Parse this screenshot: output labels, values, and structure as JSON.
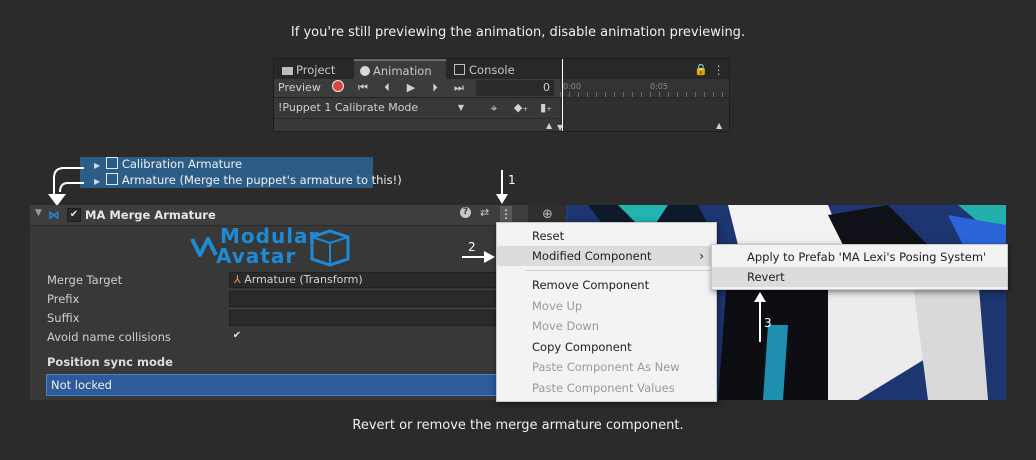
{
  "captions": {
    "top": "If you're still previewing the animation, disable animation previewing.",
    "bottom": "Revert or remove the merge armature component."
  },
  "animation_window": {
    "tabs": [
      {
        "label": "Project",
        "icon": "folder-icon"
      },
      {
        "label": "Animation",
        "icon": "clock-icon",
        "active": true
      },
      {
        "label": "Console",
        "icon": "console-icon"
      }
    ],
    "preview_label": "Preview",
    "frame_value": "0",
    "clip_name": "!Puppet 1 Calibrate Mode",
    "ticks": [
      "0:00",
      "0:05"
    ]
  },
  "hierarchy": {
    "items": [
      "Calibration Armature",
      "Armature (Merge the puppet's armature to this!)"
    ]
  },
  "inspector": {
    "component_title": "MA Merge Armature",
    "logo_line1": "Modular",
    "logo_line2": "Avatar",
    "props": {
      "merge_target_label": "Merge Target",
      "merge_target_value": "Armature (Transform)",
      "prefix_label": "Prefix",
      "prefix_value": "",
      "suffix_label": "Suffix",
      "suffix_value": "",
      "avoid_label": "Avoid name collisions",
      "avoid_checked": true
    },
    "position_sync_label": "Position sync mode",
    "position_sync_value": "Not locked"
  },
  "context_menu": {
    "items": [
      {
        "label": "Reset",
        "enabled": true
      },
      {
        "label": "Modified Component",
        "enabled": true,
        "submenu": true
      },
      {
        "label": "Remove Component",
        "enabled": true
      },
      {
        "label": "Move Up",
        "enabled": false
      },
      {
        "label": "Move Down",
        "enabled": false
      },
      {
        "label": "Copy Component",
        "enabled": true
      },
      {
        "label": "Paste Component As New",
        "enabled": false
      },
      {
        "label": "Paste Component Values",
        "enabled": false
      }
    ],
    "submenu_items": [
      {
        "label": "Apply to Prefab 'MA Lexi's Posing System'"
      },
      {
        "label": "Revert"
      }
    ]
  },
  "step_numbers": [
    "1",
    "2",
    "3"
  ],
  "colors": {
    "selection": "#2c5d87",
    "logo_blue": "#1e8ad6",
    "dropdown_blue": "#2e5b9a",
    "record_red": "#d9463b"
  }
}
